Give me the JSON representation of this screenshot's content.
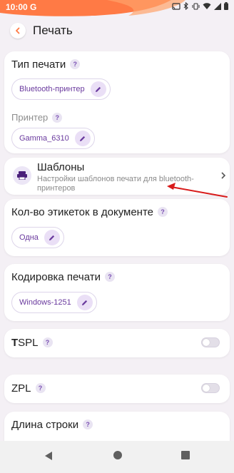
{
  "status_bar": {
    "time": "10:00",
    "g": "G",
    "icons": [
      "cast-icon",
      "bluetooth-icon",
      "vibrate-icon",
      "wifi-icon",
      "signal-icon",
      "battery-icon"
    ]
  },
  "app_bar": {
    "title": "Печать",
    "back_icon": "chevron-left-icon"
  },
  "colors": {
    "accent": "#6a3a9e",
    "orange": "#ff7a45",
    "background": "#f4f0f5",
    "arrow": "#d81b1b"
  },
  "help_mark": "?",
  "print_type": {
    "label": "Тип печати",
    "value": "Bluetooth-принтер"
  },
  "printer": {
    "label": "Принтер",
    "value": "Gamma_6310"
  },
  "templates": {
    "title": "Шаблоны",
    "subtitle": "Настройки шаблонов печати для bluetooth-принтеров"
  },
  "label_count": {
    "label": "Кол-во этикеток в документе",
    "value": "Одна"
  },
  "encoding": {
    "label": "Кодировка печати",
    "value": "Windows-1251"
  },
  "tspl": {
    "label_bold": "T",
    "label_rest": "SPL",
    "enabled": false
  },
  "zpl": {
    "label": "ZPL",
    "enabled": false
  },
  "line_length": {
    "label": "Длина строки"
  },
  "nav_bar": {
    "buttons": [
      "back-triangle-icon",
      "home-circle-icon",
      "recents-square-icon"
    ]
  }
}
